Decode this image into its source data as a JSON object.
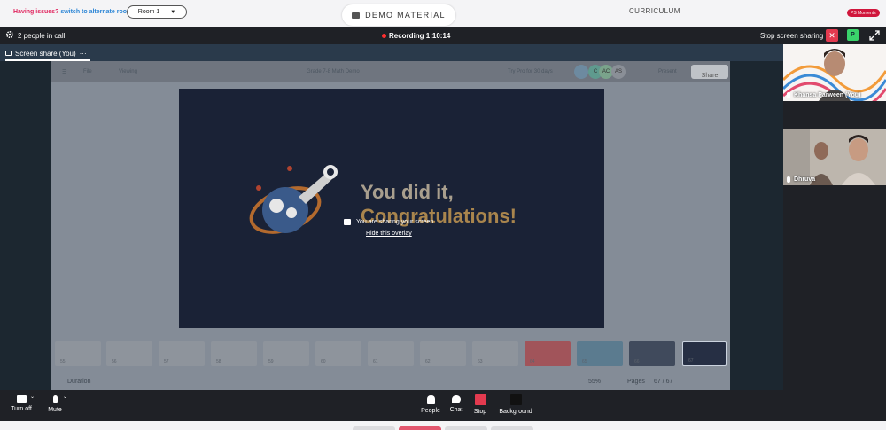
{
  "topbar": {
    "issues_text": "Having issues?",
    "alt_room_link": "switch to alternate room",
    "room_select": "Room 1",
    "demo_material": "DEMO MATERIAL",
    "curriculum": "CURRICULUM",
    "ps_moments": "PS Moments"
  },
  "call": {
    "people_count": "2 people in call",
    "recording": "Recording 1:10:14",
    "stop_sharing": "Stop screen sharing",
    "close_x": "✕",
    "p_button": "P",
    "share_tab": "Screen share (You)",
    "tab_more": "···"
  },
  "shared_app": {
    "file_menu": "File",
    "viewing": "Viewing",
    "doc_title": "Grade 7-8 Math Demo",
    "try_pro": "Try Pro for 30 days",
    "present": "Present",
    "share": "Share",
    "avatars": [
      "C",
      "AC",
      "AS"
    ],
    "slide_line1": "You did it,",
    "slide_line2": "Congratulations!",
    "thumb_numbers": [
      "55",
      "56",
      "57",
      "58",
      "59",
      "60",
      "61",
      "62",
      "63",
      "64",
      "65",
      "66",
      "67"
    ],
    "duration": "Duration",
    "zoom": "55%",
    "pages_label": "Pages",
    "page_count": "67 / 67"
  },
  "overlay": {
    "title": "You are sharing your screen",
    "hide_link": "Hide this overlay"
  },
  "participants": [
    {
      "name": "Khansa Parween (You)"
    },
    {
      "name": "Dhruva"
    }
  ],
  "controls": {
    "turn_off": "Turn off",
    "mute": "Mute",
    "people": "People",
    "chat": "Chat",
    "stop": "Stop",
    "background": "Background"
  }
}
